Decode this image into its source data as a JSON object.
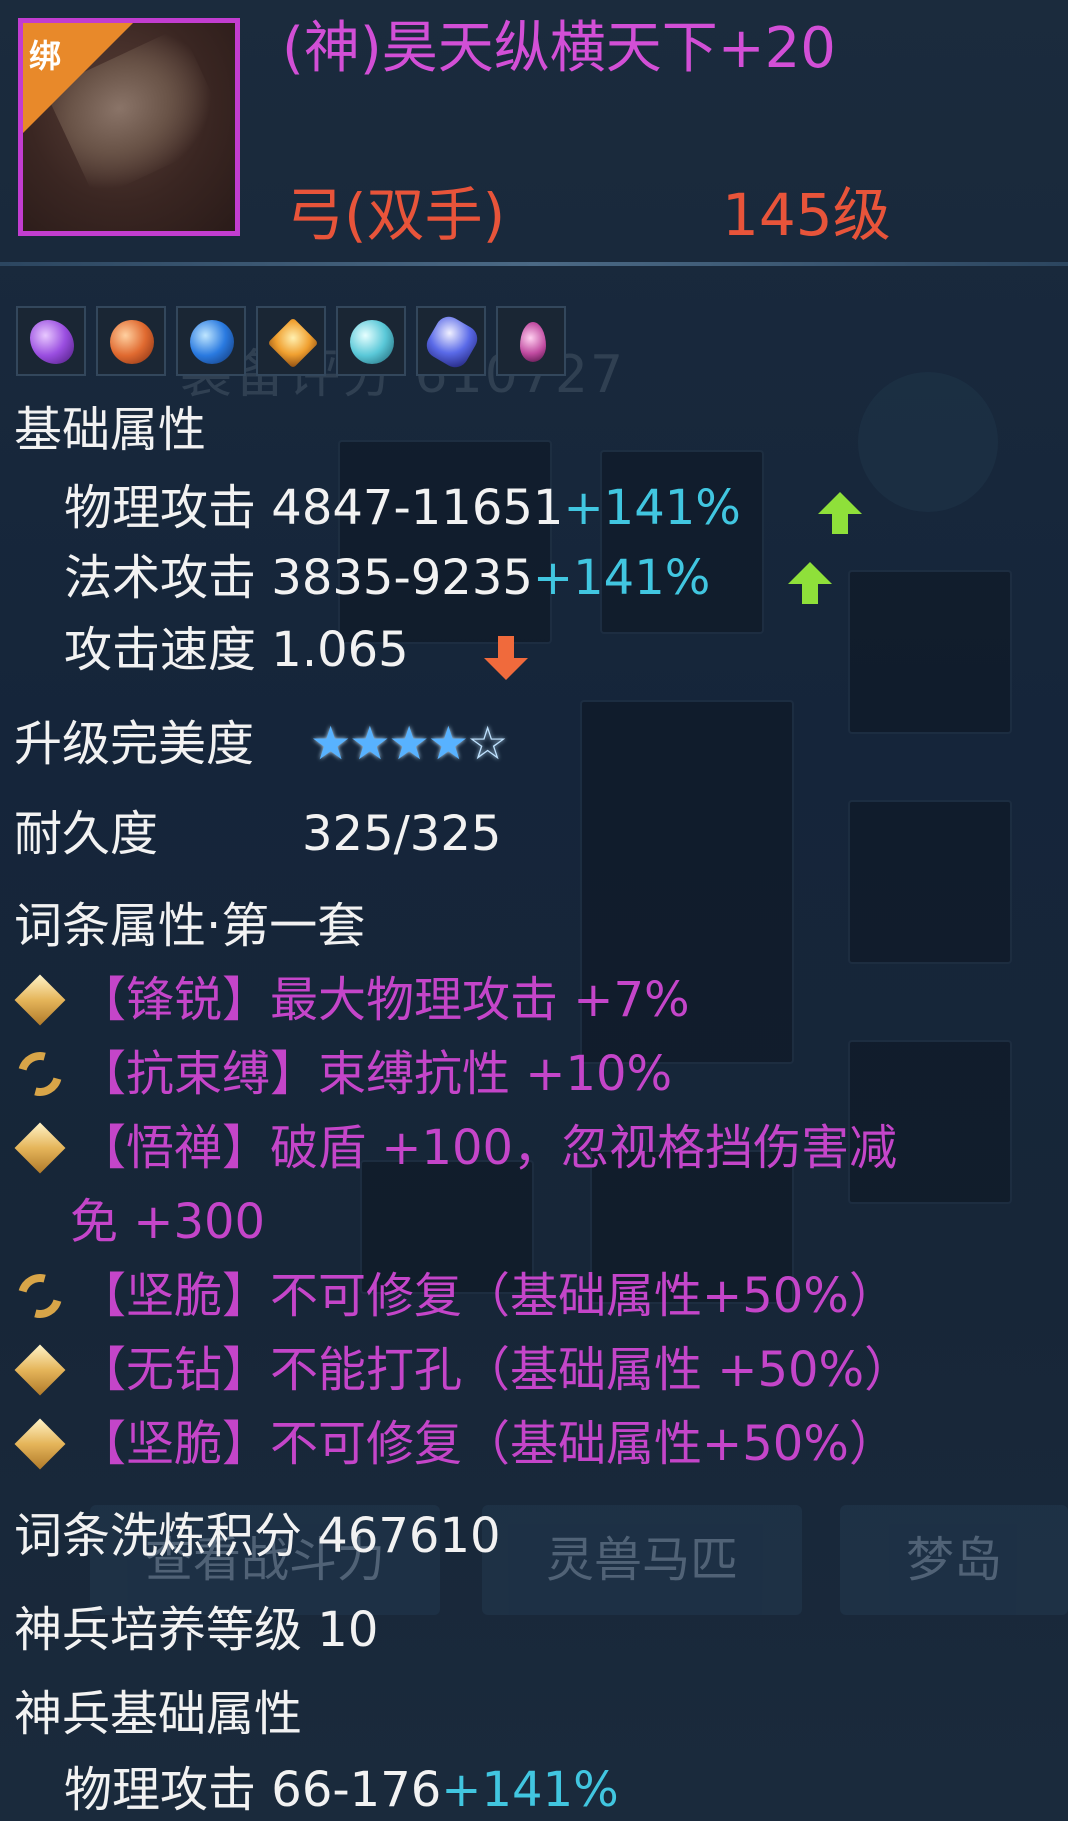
{
  "item": {
    "bind_label": "绑",
    "name": "(神)昊天纵横天下+20",
    "type": "弓(双手)",
    "level": "145级"
  },
  "gems": [
    "purple-gem-icon",
    "orange-gem-icon",
    "blue-gem-icon",
    "amber-gem-icon",
    "cyan-gem-icon",
    "sapphire-gem-icon",
    "pink-gem-icon"
  ],
  "background": {
    "score_ghost": "装备评分 610727",
    "buttons": [
      "查看战斗力",
      "灵兽马匹",
      "梦岛"
    ]
  },
  "basic": {
    "header": "基础属性",
    "phys_label": "物理攻击",
    "phys_value": "4847-11651",
    "phys_bonus": "+141%",
    "mag_label": "法术攻击",
    "mag_value": "3835-9235",
    "mag_bonus": "+141%",
    "speed_label": "攻击速度",
    "speed_value": "1.065"
  },
  "perfection": {
    "label": "升级完美度",
    "stars_filled": 4,
    "stars_total": 5
  },
  "durability": {
    "label": "耐久度",
    "value": "325/325"
  },
  "affix": {
    "header": "词条属性·第一套",
    "lines": [
      {
        "icon": "diamond-icon",
        "text": "【锋锐】最大物理攻击 +7%"
      },
      {
        "icon": "swirl-icon",
        "text": "【抗束缚】束缚抗性 +10%"
      },
      {
        "icon": "diamond-icon",
        "text": "【悟禅】破盾 +100，忽视格挡伤害减",
        "cont": "免 +300"
      },
      {
        "icon": "swirl-icon",
        "text": "【坚脆】不可修复（基础属性+50%）"
      },
      {
        "icon": "diamond-icon",
        "text": "【无钻】不能打孔（基础属性 +50%）"
      },
      {
        "icon": "diamond-icon",
        "text": "【坚脆】不可修复（基础属性+50%）"
      }
    ]
  },
  "refine": {
    "label": "词条洗炼积分",
    "value": "467610"
  },
  "divine_level": {
    "label": "神兵培养等级",
    "value": "10"
  },
  "divine_basic": {
    "header": "神兵基础属性",
    "phys_label": "物理攻击",
    "phys_value": "66-176",
    "phys_bonus": "+141%"
  },
  "colors": {
    "name": "#d24fd6",
    "type": "#e8543a",
    "bonus": "#41c6e0",
    "affix": "#c445c9",
    "up": "#8fe03a",
    "down": "#f06a3c"
  }
}
